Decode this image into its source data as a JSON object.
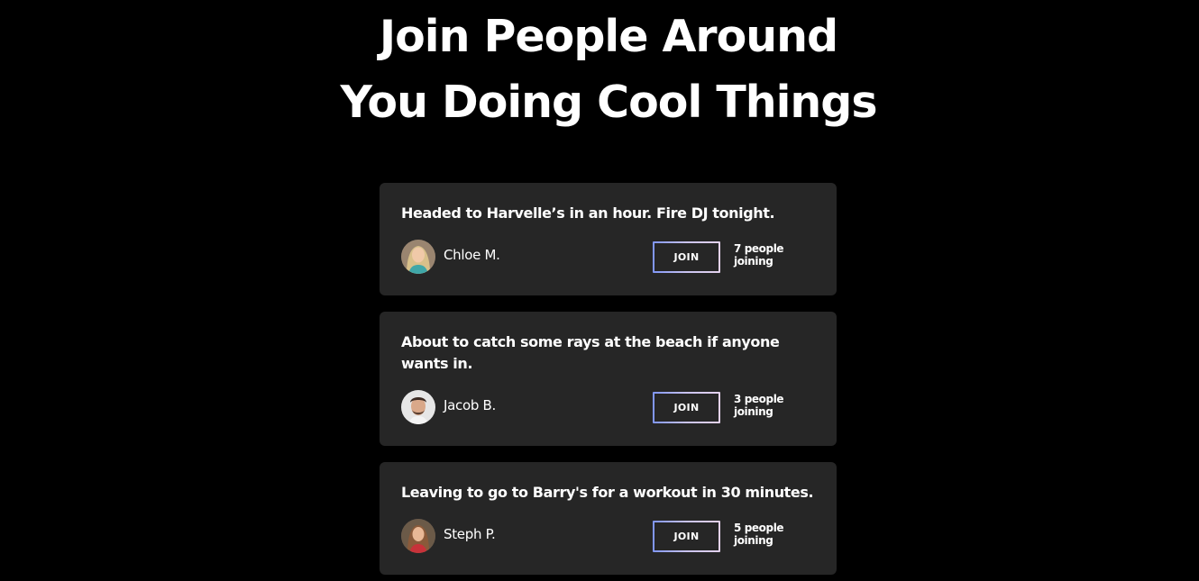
{
  "hero": {
    "line1": "Join People Around",
    "line2": "You Doing Cool Things"
  },
  "posts": [
    {
      "text": "Headed to Harvelle’s in an hour. Fire DJ tonight.",
      "user": "Chloe M.",
      "avatar_icon": "avatar-chloe",
      "join_label": "JOIN",
      "joining": "7 people joining"
    },
    {
      "text": "About to catch some rays at the beach if anyone wants in.",
      "user": "Jacob B.",
      "avatar_icon": "avatar-jacob",
      "join_label": "JOIN",
      "joining": "3 people joining"
    },
    {
      "text": "Leaving to go to Barry's for a workout in 30 minutes.",
      "user": "Steph P.",
      "avatar_icon": "avatar-steph",
      "join_label": "JOIN",
      "joining": "5 people joining"
    }
  ],
  "colors": {
    "background": "#000000",
    "card": "#262626",
    "text": "#ffffff",
    "button_border_start": "#7f95f5",
    "button_border_end": "#e4d2ee"
  }
}
